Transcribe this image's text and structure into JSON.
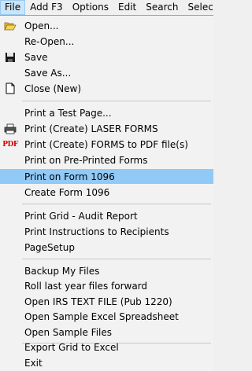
{
  "menubar": {
    "items": [
      "File",
      "Add F3",
      "Options",
      "Edit",
      "Search",
      "Select Fo"
    ]
  },
  "menu": {
    "open": "Open...",
    "reopen": "Re-Open...",
    "save": "Save",
    "save_as": "Save As...",
    "close_new": "Close (New)",
    "print_test_page": "Print a Test Page...",
    "print_laser_forms": "Print (Create) LASER FORMS",
    "print_forms_pdf": "Print (Create) FORMS to PDF file(s)",
    "print_preprinted": "Print on Pre-Printed Forms",
    "print_form_1096": "Print on Form 1096",
    "create_form_1096": "Create Form 1096",
    "print_grid_audit": "Print Grid - Audit Report",
    "print_instructions": "Print Instructions to Recipients",
    "page_setup": "PageSetup",
    "backup_files": "Backup My Files",
    "roll_last_year": "Roll last year files forward",
    "open_irs_text": "Open IRS TEXT FILE (Pub 1220)",
    "open_sample_excel": "Open Sample Excel Spreadsheet",
    "open_sample_files": "Open Sample Files",
    "export_grid_excel": "Export Grid to Excel",
    "exit": "Exit"
  },
  "icons": {
    "pdf_text": "PDF"
  },
  "colors": {
    "highlight": "#91c9f7",
    "pdf_red": "#d40000"
  }
}
